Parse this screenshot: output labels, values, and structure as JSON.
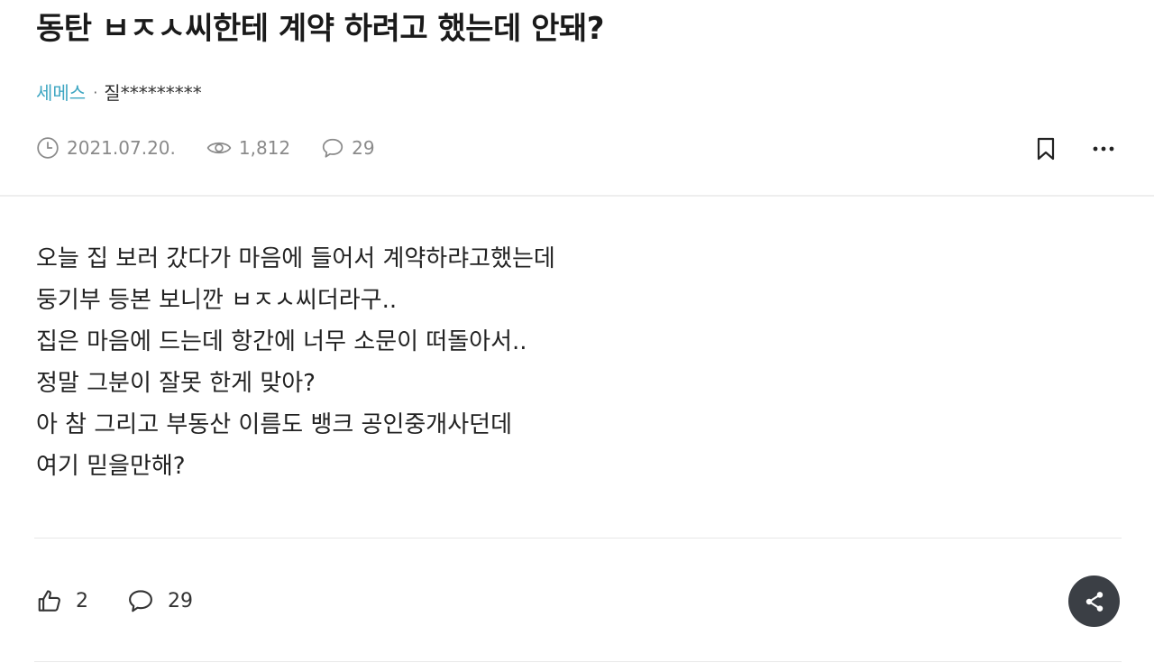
{
  "post": {
    "title": "동탄 ㅂㅈㅅ씨한테 계약 하려고 했는데 안돼?",
    "board": "세메스",
    "separator": "·",
    "author": "질*********",
    "date": "2021.07.20.",
    "views": "1,812",
    "comment_count": "29",
    "body_lines": [
      "오늘 집 보러 갔다가 마음에 들어서 계약하랴고했는데",
      "둥기부 등본 보니깐 ㅂㅈㅅ씨더라구..",
      "집은 마음에 드는데 항간에 너무 소문이 떠돌아서..",
      "정말 그분이 잘못 한게 맞아?",
      "아 참 그리고 부동산 이름도 뱅크 공인중개사던데",
      "여기 믿을만해?"
    ]
  },
  "actions": {
    "likes": "2",
    "comments": "29"
  },
  "icons": {
    "date": "clock-icon",
    "views": "eye-icon",
    "comments": "speech-bubble-icon",
    "bookmark": "bookmark-icon",
    "more": "more-horizontal-icon",
    "like": "thumbs-up-icon",
    "share": "share-icon"
  },
  "colors": {
    "board_link": "#3ea6c2",
    "meta_text": "#8a8a8a",
    "share_button": "#3b3f45"
  }
}
